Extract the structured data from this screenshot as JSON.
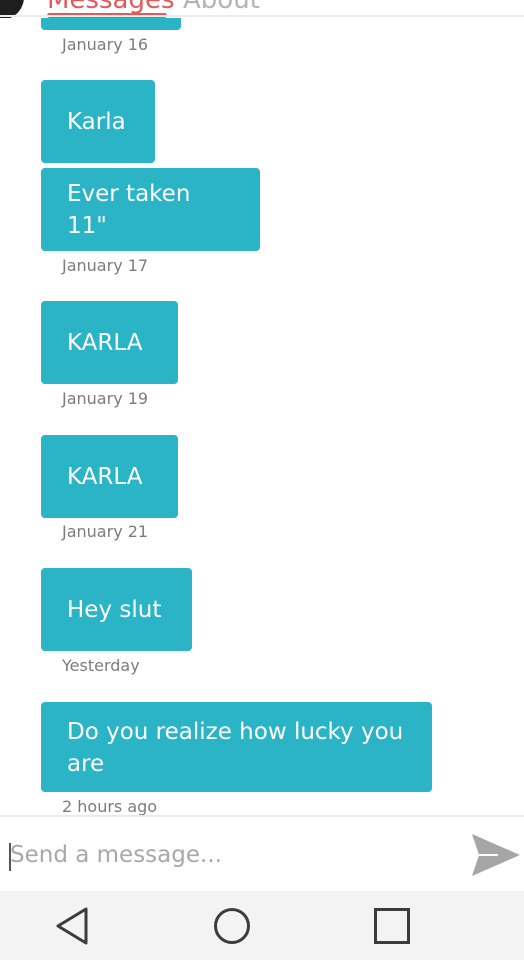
{
  "header": {
    "tabs": [
      {
        "label": "Messages",
        "active": true
      },
      {
        "label": "About",
        "active": false
      }
    ]
  },
  "thread": {
    "messages": [
      {
        "text": "",
        "time": "January 16"
      },
      {
        "text": "Karla",
        "time": ""
      },
      {
        "text": "Ever taken 11\"",
        "time": "January 17"
      },
      {
        "text": "KARLA",
        "time": "January 19"
      },
      {
        "text": "KARLA",
        "time": "January 21"
      },
      {
        "text": "Hey slut",
        "time": "Yesterday"
      },
      {
        "text": "Do you realize how lucky you are",
        "time": "2 hours ago"
      }
    ]
  },
  "composer": {
    "value": "",
    "placeholder": "Send a message..."
  },
  "navbar": {
    "icons": [
      "back-icon",
      "home-icon",
      "recents-icon"
    ]
  },
  "colors": {
    "bubble": "#2bb3c6",
    "accent": "#e4595c",
    "timestamp": "#7c7c7c",
    "send_icon": "#a6a6a6"
  }
}
